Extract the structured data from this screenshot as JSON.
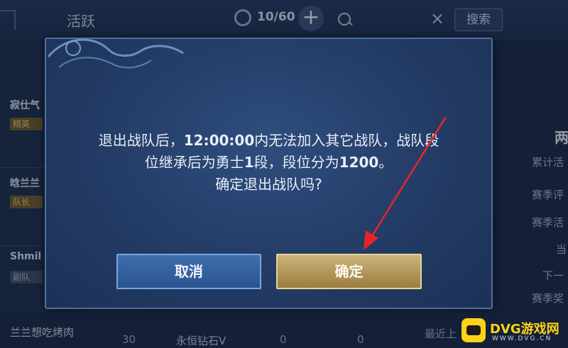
{
  "header": {
    "tab_active": "活跃",
    "member_count": "10/60",
    "add_symbol": "+",
    "close_symbol": "×",
    "search_button": "搜索"
  },
  "left_list": [
    {
      "name": "寂仕气",
      "badge": "精英"
    },
    {
      "name": "晗兰兰",
      "badge": "队长"
    },
    {
      "name": "Shmil",
      "badge": "副队"
    }
  ],
  "right_panel": {
    "title": "两",
    "items": [
      "累计活",
      "赛季评",
      "赛季活",
      "当",
      "下一",
      "赛季奖"
    ]
  },
  "bottom_row": {
    "name": "兰兰想吃烤肉",
    "level": "30",
    "rank": "永恒钻石V",
    "val1": "0",
    "val2": "0",
    "last": "最近上"
  },
  "dialog": {
    "line1_pre": "退出战队后，",
    "line1_time": "12:00:00",
    "line1_post": "内无法加入其它战队，战队段",
    "line2_pre": "位继承后为勇士",
    "line2_num": "1",
    "line2_mid": "段，段位分为",
    "line2_score": "1200",
    "line2_post": "。",
    "line3": "确定退出战队吗?",
    "cancel_label": "取消",
    "confirm_label": "确定"
  },
  "watermark": {
    "text": "DVG游戏网",
    "sub": "WWW.DVG.CN"
  },
  "colors": {
    "cancel": "#2f5a99",
    "confirm": "#b89a5a",
    "arrow": "#e8242a"
  }
}
